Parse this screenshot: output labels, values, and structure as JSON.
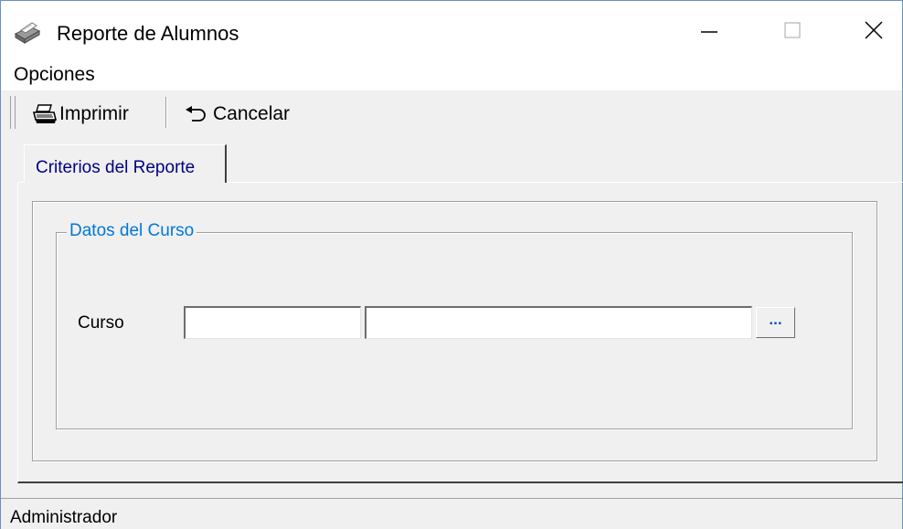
{
  "window": {
    "title": "Reporte de Alumnos",
    "app_icon": "printer-icon",
    "controls": {
      "minimize": "minimize-icon",
      "maximize": "maximize-icon",
      "close": "close-icon"
    }
  },
  "menubar": {
    "items": [
      {
        "label": "Opciones"
      }
    ]
  },
  "toolbar": {
    "print": {
      "label": "Imprimir",
      "icon": "printer-icon"
    },
    "cancel": {
      "label": "Cancelar",
      "icon": "undo-arrow-icon"
    }
  },
  "tabs": [
    {
      "label": "Criterios del Reporte",
      "active": true
    }
  ],
  "group": {
    "title": "Datos del Curso",
    "fields": {
      "curso": {
        "label": "Curso",
        "code_value": "",
        "name_value": "",
        "browse_label": "..."
      }
    }
  },
  "statusbar": {
    "text": "Administrador"
  },
  "colors": {
    "window_bg": "#f0f0f0",
    "tab_label": "#000080",
    "group_title": "#0078d7",
    "browse_dots": "#0054b4"
  }
}
